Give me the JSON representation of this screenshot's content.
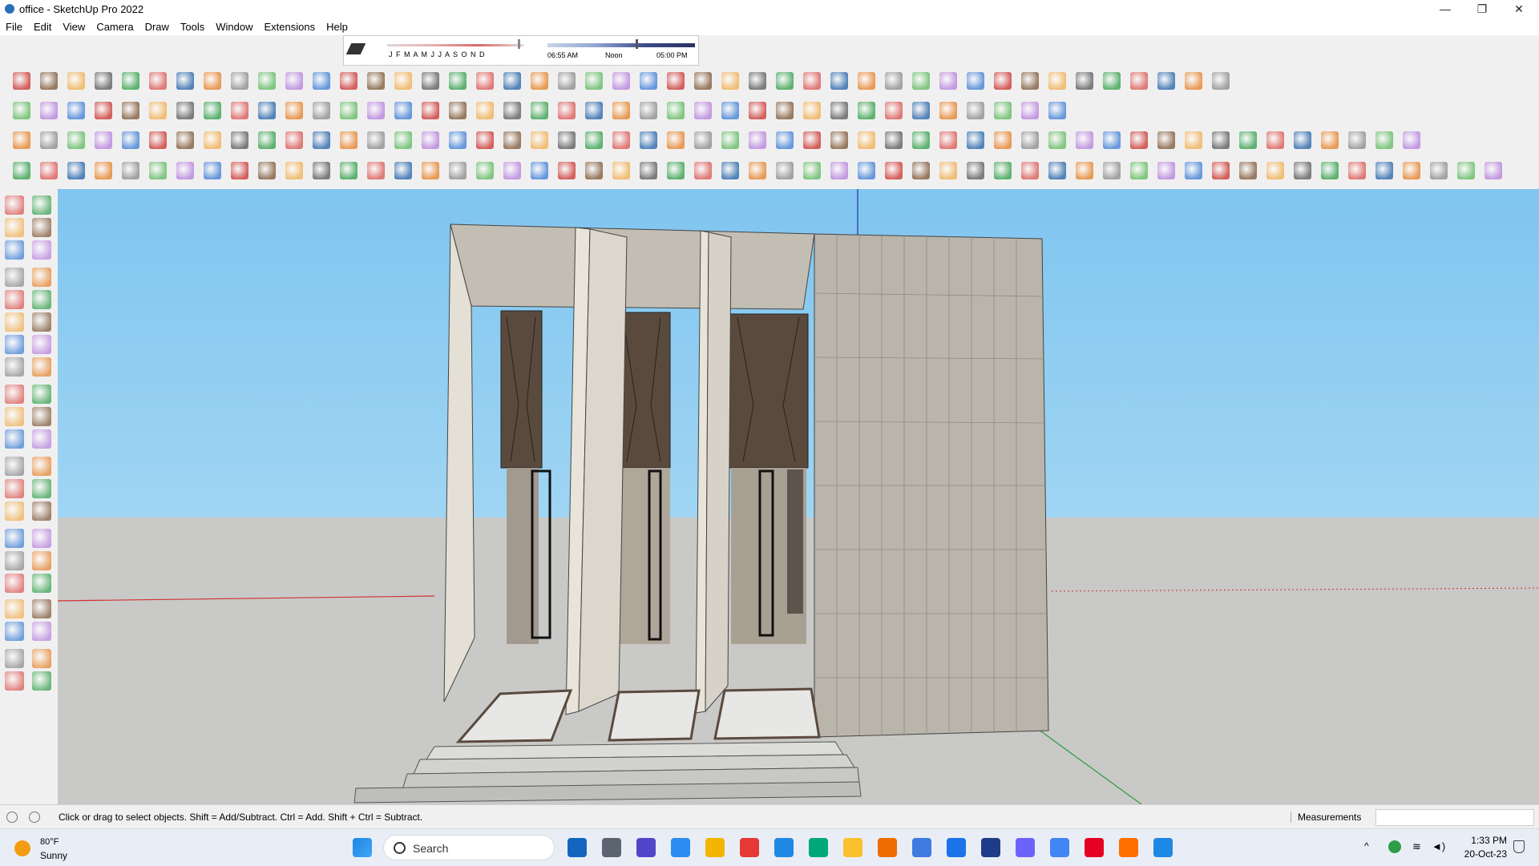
{
  "window": {
    "title": "office - SketchUp Pro 2022",
    "min": "—",
    "max": "❐",
    "close": "✕"
  },
  "menu": [
    "File",
    "Edit",
    "View",
    "Camera",
    "Draw",
    "Tools",
    "Window",
    "Extensions",
    "Help"
  ],
  "shadows": {
    "months": "J F M A M J J A S O N D",
    "sunrise": "06:55 AM",
    "noon": "Noon",
    "sunset": "05:00 PM"
  },
  "colors": {
    "sky_top": "#7fc5ef",
    "ground": "#c9c9c7",
    "red_axis": "#d03030",
    "green_axis": "#2f9a3f",
    "blue_axis": "#2030a0",
    "wall": "#d8d3c7",
    "dark_panel": "#5a4a3e"
  },
  "status": {
    "message": "Click or drag to select objects. Shift = Add/Subtract. Ctrl = Add. Shift + Ctrl = Subtract.",
    "measurements_label": "Measurements",
    "measurements_value": ""
  },
  "taskbar": {
    "temperature": "80°F",
    "condition": "Sunny",
    "search_label": "Search",
    "time": "1:33 PM",
    "date": "20-Oct-23"
  }
}
